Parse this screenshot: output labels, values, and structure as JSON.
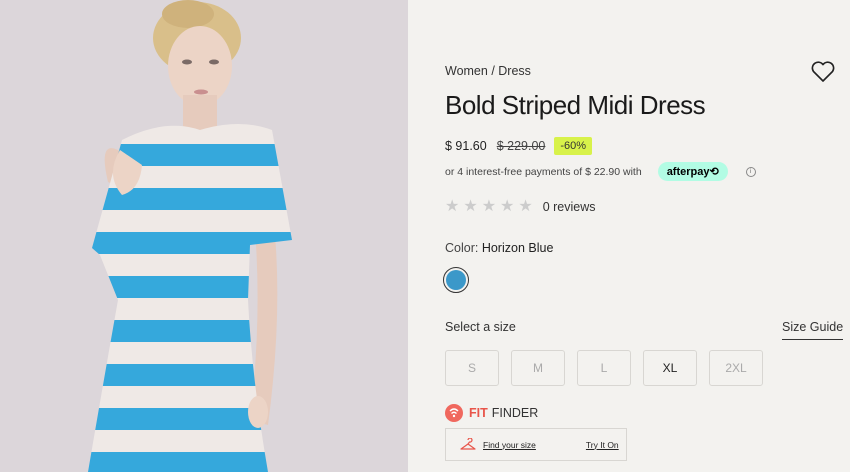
{
  "product": {
    "breadcrumb": "Women / Dress",
    "title": "Bold Striped Midi Dress",
    "price_current": "$ 91.60",
    "price_original": "$ 229.00",
    "discount": "-60%",
    "installments_text": "or 4 interest-free payments of $ 22.90 with",
    "afterpay_label": "afterpay⟲",
    "rating_stars": 0,
    "reviews_text": "0 reviews",
    "color_label": "Color:",
    "color_value": "Horizon Blue",
    "swatch_color": "#3b98c9"
  },
  "sizes": {
    "label": "Select a size",
    "guide_label": "Size Guide",
    "options": [
      {
        "label": "S",
        "available": false
      },
      {
        "label": "M",
        "available": false
      },
      {
        "label": "L",
        "available": false
      },
      {
        "label": "XL",
        "available": true
      },
      {
        "label": "2XL",
        "available": false
      }
    ]
  },
  "fit_finder": {
    "brand_fit": "FIT",
    "brand_finder": "FINDER",
    "find_size_label": "Find your size",
    "try_on_label": "Try It On"
  },
  "icons": {
    "wishlist": "heart-icon",
    "info": "info-icon",
    "star": "star-icon",
    "fit_finder": "fit-finder-logo-icon",
    "hanger": "hanger-icon"
  },
  "colors": {
    "accent_discount": "#d8f24a",
    "afterpay": "#b2fce4",
    "fit_finder_brand": "#e8554a",
    "stripe_blue": "#35a8dc"
  }
}
